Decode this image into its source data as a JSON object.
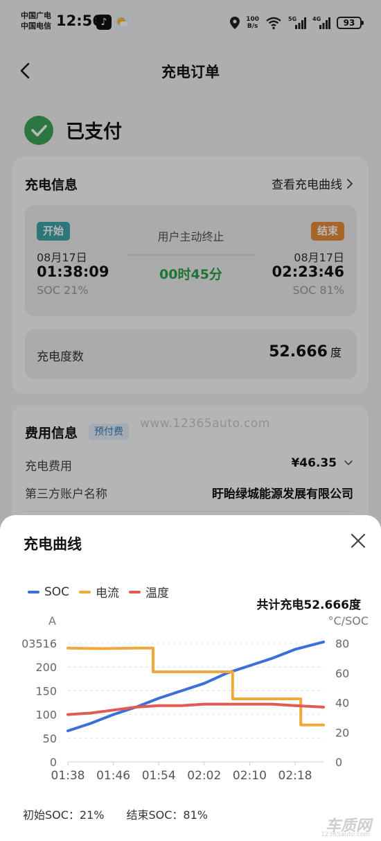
{
  "status_bar": {
    "carrier_1": "中国广电",
    "carrier_2": "中国电信",
    "time": "12:56",
    "net_speed_value": "100",
    "net_speed_unit": "B/s",
    "signal_1": "5G",
    "signal_2": "4G",
    "battery": "93"
  },
  "header": {
    "title": "充电订单"
  },
  "payment": {
    "status": "已支付"
  },
  "charge_info": {
    "title": "充电信息",
    "view_curve_link": "查看充电曲线",
    "start_tag": "开始",
    "end_tag": "结束",
    "start_date": "08月17日",
    "start_time": "01:38:09",
    "start_soc": "SOC 21%",
    "end_date": "08月17日",
    "end_time": "02:23:46",
    "end_soc": "SOC 81%",
    "stop_reason": "用户主动终止",
    "duration": "00时45分",
    "energy_label": "充电度数",
    "energy_value": "52.666",
    "energy_unit": "度"
  },
  "fee_info": {
    "title": "费用信息",
    "badge": "预付费",
    "watermark": "www.12365auto.com",
    "fee_label": "充电费用",
    "fee_value": "¥46.35",
    "account_label": "第三方账户名称",
    "account_value": "盱眙绿城能源发展有限公司"
  },
  "sheet": {
    "title": "充电曲线",
    "total_energy": "共计充电52.666度",
    "initial_soc": "初始SOC：21%",
    "final_soc": "结束SOC：81%"
  },
  "watermark_logo": {
    "text": "车质网",
    "sub": "12365auto.com"
  },
  "colors": {
    "soc": "#3b6fd9",
    "current": "#f0a83a",
    "temperature": "#e05a56",
    "paid_green": "#3ea55a",
    "start_tag": "#3fa4a8",
    "end_tag": "#e98d3b"
  },
  "icons": {
    "back": "chevron-left-icon",
    "paid": "check-circle-icon",
    "link": "chevron-right-icon",
    "fee_dropdown": "chevron-down-icon",
    "close": "close-icon",
    "location": "location-icon",
    "wifi": "wifi-icon",
    "signal": "signal-icon",
    "battery": "battery-icon"
  },
  "chart_data": {
    "type": "line",
    "legend": [
      "SOC",
      "电流",
      "温度"
    ],
    "legend_position": "top-left",
    "left_axis_label": "A",
    "right_axis_label": "°C/SOC",
    "left_axis_ticks": [
      "03516",
      "200",
      "150",
      "100",
      "50",
      "0"
    ],
    "right_axis_ticks": [
      "80",
      "60",
      "40",
      "20",
      "0"
    ],
    "ylim_left": [
      0,
      250
    ],
    "ylim_right": [
      0,
      80
    ],
    "x_ticks": [
      "01:38",
      "01:46",
      "01:54",
      "02:02",
      "02:10",
      "02:18"
    ],
    "grid": "horizontal dashed",
    "series": [
      {
        "name": "SOC",
        "axis": "right",
        "x": [
          "01:38",
          "01:42",
          "01:46",
          "01:50",
          "01:54",
          "01:58",
          "02:02",
          "02:06",
          "02:10",
          "02:14",
          "02:18",
          "02:23"
        ],
        "values": [
          21,
          26,
          32,
          37,
          43,
          48,
          53,
          60,
          65,
          70,
          76,
          81
        ]
      },
      {
        "name": "电流",
        "axis": "left",
        "x": [
          "01:38",
          "01:44",
          "01:50",
          "01:53",
          "01:53",
          "01:58",
          "02:06",
          "02:07",
          "02:07",
          "02:15",
          "02:19",
          "02:19",
          "02:23"
        ],
        "values": [
          240,
          239,
          240,
          240,
          190,
          190,
          190,
          190,
          133,
          133,
          133,
          78,
          78
        ]
      },
      {
        "name": "温度",
        "axis": "right",
        "x": [
          "01:38",
          "01:42",
          "01:46",
          "01:50",
          "01:54",
          "01:58",
          "02:02",
          "02:06",
          "02:10",
          "02:14",
          "02:18",
          "02:23"
        ],
        "values": [
          32,
          33,
          35,
          37,
          38,
          38,
          39,
          39,
          39,
          39,
          38,
          37
        ]
      }
    ]
  }
}
